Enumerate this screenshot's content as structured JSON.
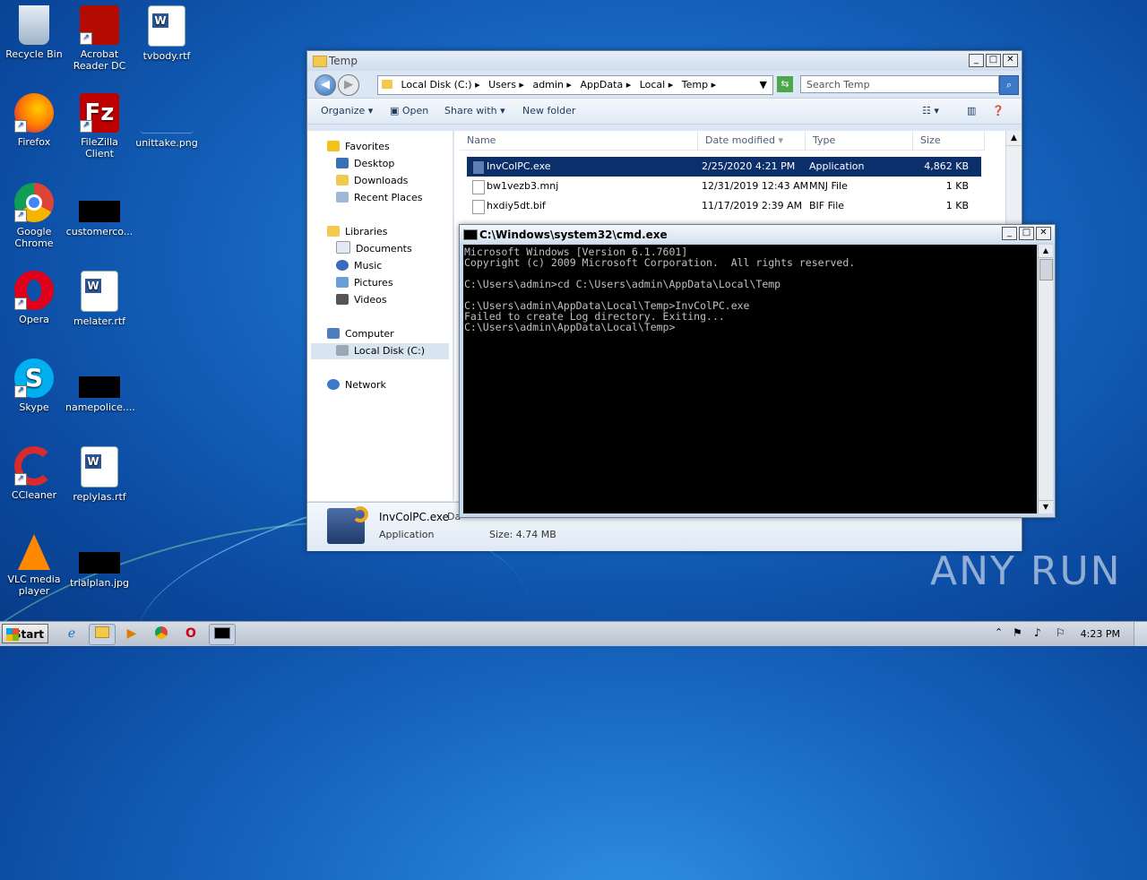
{
  "desktop": {
    "icons": [
      {
        "label": "Recycle Bin"
      },
      {
        "label": "Acrobat Reader DC"
      },
      {
        "label": "tvbody.rtf"
      },
      {
        "label": "Firefox"
      },
      {
        "label": "FileZilla Client"
      },
      {
        "label": "unittake.png"
      },
      {
        "label": "Google Chrome"
      },
      {
        "label": "customerco..."
      },
      {
        "label": "Opera"
      },
      {
        "label": "melater.rtf"
      },
      {
        "label": "Skype"
      },
      {
        "label": "namepolice...."
      },
      {
        "label": "CCleaner"
      },
      {
        "label": "replylas.rtf"
      },
      {
        "label": "VLC media player"
      },
      {
        "label": "trialplan.jpg"
      }
    ],
    "watermark": "ANY RUN"
  },
  "explorer": {
    "title": "Temp",
    "breadcrumb": [
      "Local Disk (C:)",
      "Users",
      "admin",
      "AppData",
      "Local",
      "Temp"
    ],
    "search_placeholder": "Search Temp",
    "toolbar": {
      "organize": "Organize",
      "open": "Open",
      "share_with": "Share with",
      "new_folder": "New folder"
    },
    "nav": {
      "favorites": "Favorites",
      "desktop": "Desktop",
      "downloads": "Downloads",
      "recent_places": "Recent Places",
      "libraries": "Libraries",
      "documents": "Documents",
      "music": "Music",
      "pictures": "Pictures",
      "videos": "Videos",
      "computer": "Computer",
      "local_disk": "Local Disk (C:)",
      "network": "Network"
    },
    "columns": {
      "name": "Name",
      "date_modified": "Date modified",
      "type": "Type",
      "size": "Size"
    },
    "files": [
      {
        "name": "InvColPC.exe",
        "date": "2/25/2020 4:21 PM",
        "type": "Application",
        "size": "4,862 KB"
      },
      {
        "name": "bw1vezb3.mnj",
        "date": "12/31/2019 12:43 AM",
        "type": "MNJ File",
        "size": "1 KB"
      },
      {
        "name": "hxdiy5dt.bif",
        "date": "11/17/2019 2:39 AM",
        "type": "BIF File",
        "size": "1 KB"
      }
    ],
    "details": {
      "name": "InvColPC.exe",
      "name_suffix": "Da",
      "type": "Application",
      "size": "Size: 4.74 MB"
    }
  },
  "cmd": {
    "title": "C:\\Windows\\system32\\cmd.exe",
    "output": "Microsoft Windows [Version 6.1.7601]\nCopyright (c) 2009 Microsoft Corporation.  All rights reserved.\n\nC:\\Users\\admin>cd C:\\Users\\admin\\AppData\\Local\\Temp\n\nC:\\Users\\admin\\AppData\\Local\\Temp>InvColPC.exe\nFailed to create Log directory. Exiting...\nC:\\Users\\admin\\AppData\\Local\\Temp>"
  },
  "taskbar": {
    "start": "Start",
    "clock": "4:23 PM"
  }
}
